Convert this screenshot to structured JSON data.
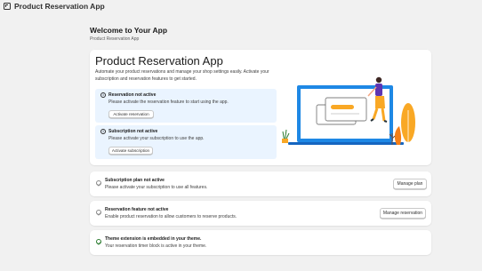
{
  "topbar": {
    "icon": "app-window-icon",
    "title": "Product Reservation App"
  },
  "header": {
    "title": "Welcome to Your App",
    "subtitle": "Product Reservation App"
  },
  "hero": {
    "title": "Product Reservation App",
    "description": "Automate your product reservations and manage your shop settings easily. Activate your subscription and reservation features to get started.",
    "alerts": [
      {
        "icon": "info-icon",
        "title": "Reservation not active",
        "text": "Please activate the reservation feature to start using the app.",
        "button": "Activate reservation"
      },
      {
        "icon": "info-icon",
        "title": "Subscription not active",
        "text": "Please activate your subscription to use the app.",
        "button": "Activate subscription"
      }
    ]
  },
  "status_rows": [
    {
      "icon": "check-circle-icon",
      "title": "Subscription plan not active",
      "text": "Please activate your subscription to use all features.",
      "button": "Manage plan"
    },
    {
      "icon": "check-circle-icon",
      "title": "Reservation feature not active",
      "text": "Enable product reservation to allow customers to reserve products.",
      "button": "Manage reservation"
    },
    {
      "icon": "check-circle-icon",
      "title": "Theme extension is embedded in your theme.",
      "text": "Your reservation timer block is active in your theme."
    }
  ],
  "colors": {
    "background": "#f1f1f1",
    "card": "#ffffff",
    "alert_bg": "#eaf4ff",
    "illustration_blue": "#1e88e5",
    "illustration_yellow": "#f9a825",
    "illustration_purple": "#5e35b1",
    "success_green": "#2e7d32"
  }
}
